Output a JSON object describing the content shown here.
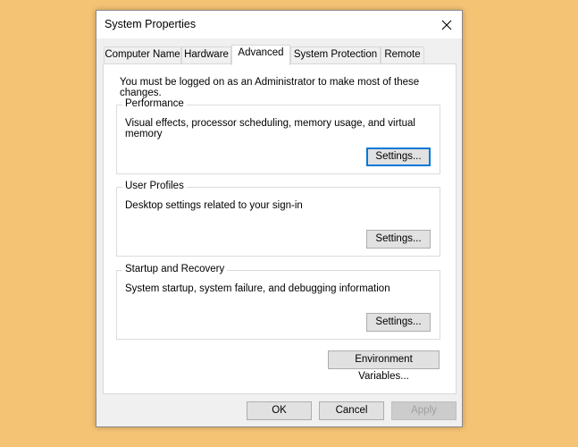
{
  "window": {
    "title": "System Properties",
    "close_icon": "close-icon"
  },
  "tabs": [
    {
      "label": "Computer Name",
      "active": false
    },
    {
      "label": "Hardware",
      "active": false
    },
    {
      "label": "Advanced",
      "active": true
    },
    {
      "label": "System Protection",
      "active": false
    },
    {
      "label": "Remote",
      "active": false
    }
  ],
  "advanced": {
    "notice": "You must be logged on as an Administrator to make most of these changes.",
    "performance": {
      "title": "Performance",
      "description": "Visual effects, processor scheduling, memory usage, and virtual memory",
      "button": "Settings..."
    },
    "user_profiles": {
      "title": "User Profiles",
      "description": "Desktop settings related to your sign-in",
      "button": "Settings..."
    },
    "startup_recovery": {
      "title": "Startup and Recovery",
      "description": "System startup, system failure, and debugging information",
      "button": "Settings..."
    },
    "env_button": "Environment Variables..."
  },
  "footer": {
    "ok": "OK",
    "cancel": "Cancel",
    "apply": "Apply"
  },
  "colors": {
    "desktop_background": "#f5c374",
    "focus_border": "#0078d7"
  }
}
